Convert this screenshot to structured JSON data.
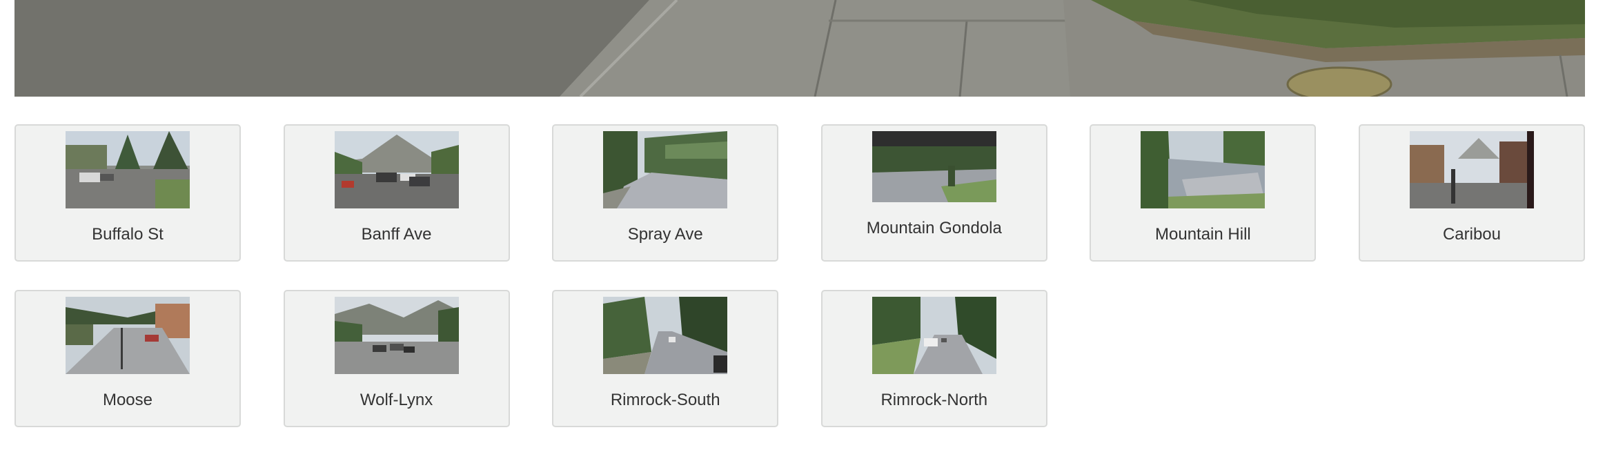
{
  "main_camera": {
    "icon": "street-scene-image"
  },
  "cameras": [
    {
      "label": "Buffalo St",
      "scene": "street-town"
    },
    {
      "label": "Banff Ave",
      "scene": "street-mountain-cars"
    },
    {
      "label": "Spray Ave",
      "scene": "road-forest"
    },
    {
      "label": "Mountain Gondola",
      "scene": "gondola-overhang"
    },
    {
      "label": "Mountain Hill",
      "scene": "hillside-lot"
    },
    {
      "label": "Caribou",
      "scene": "street-buildings"
    },
    {
      "label": "Moose",
      "scene": "street-town-long"
    },
    {
      "label": "Wolf-Lynx",
      "scene": "street-parking"
    },
    {
      "label": "Rimrock-South",
      "scene": "road-forest-south"
    },
    {
      "label": "Rimrock-North",
      "scene": "road-forest-north"
    }
  ],
  "colors": {
    "card_bg": "#f1f2f1",
    "card_border": "#d8d9d8",
    "label_text": "#333333"
  }
}
